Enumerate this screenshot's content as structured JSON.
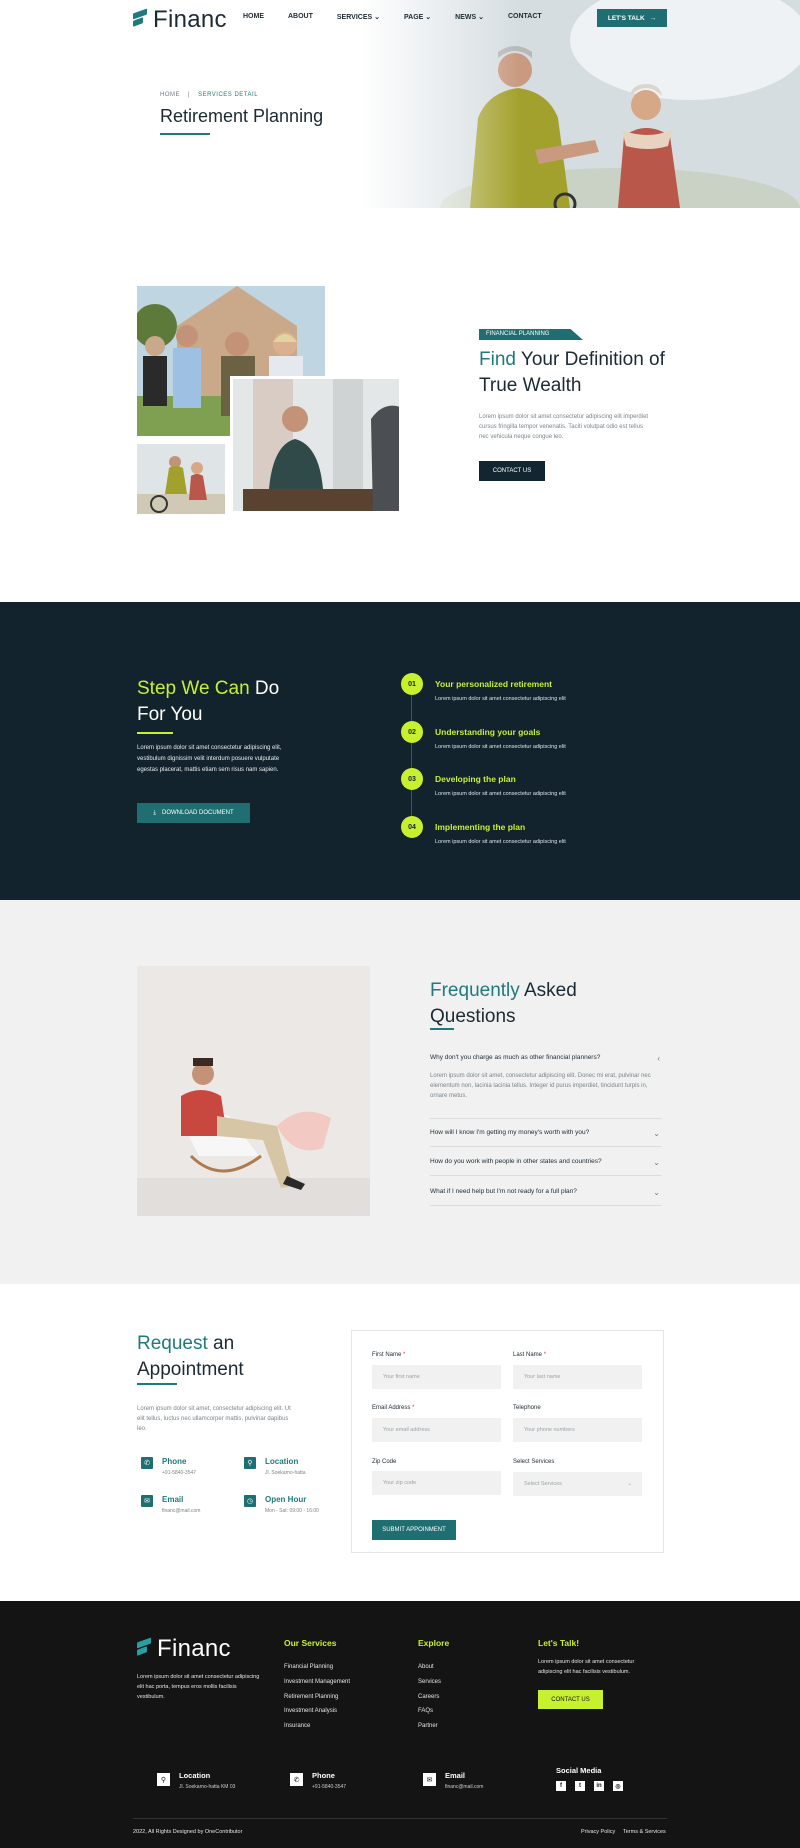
{
  "header": {
    "logo": "Financ",
    "nav": [
      "HOME",
      "ABOUT",
      "SERVICES",
      "PAGE",
      "NEWS",
      "CONTACT"
    ],
    "nav_dropdowns": [
      "SERVICES",
      "PAGE",
      "NEWS"
    ],
    "cta": "LET'S TALK"
  },
  "hero": {
    "breadcrumb_home": "HOME",
    "breadcrumb_current": "SERVICES DETAIL",
    "title": "Retirement Planning"
  },
  "wealth": {
    "tag": "FINANCIAL PLANNING",
    "title_highlight": "Find",
    "title_rest": " Your Definition of",
    "title_line2": "True Wealth",
    "body": "Lorem ipsum dolor sit amet consectetur adipiscing elit imperdiet cursus fringilla tempor venenatis. Taciti volutpat odio est tellus nec vehicula neque congue leo.",
    "button": "CONTACT US"
  },
  "steps": {
    "title_highlight": "Step We Can",
    "title_rest": " Do",
    "title_line2": "For You",
    "body": "Lorem ipsum dolor sit amet consectetur adipiscing elit, vestibulum dignissim velit interdum posuere vulputate egestas placerat, mattis etiam sem risus nam sapien.",
    "button": "DOWNLOAD DOCUMENT",
    "items": [
      {
        "num": "01",
        "title": "Your personalized retirement",
        "desc": "Lorem ipsum dolor sit amet consectetur adipiscing elit"
      },
      {
        "num": "02",
        "title": "Understanding your goals",
        "desc": "Lorem ipsum dolor sit amet consectetur adipiscing elit"
      },
      {
        "num": "03",
        "title": "Developing the plan",
        "desc": "Lorem ipsum dolor sit amet consectetur adipiscing elit"
      },
      {
        "num": "04",
        "title": "Implementing the plan",
        "desc": "Lorem ipsum dolor sit amet consectetur adipiscing elit"
      }
    ]
  },
  "faq": {
    "title_highlight": "Frequently",
    "title_rest": " Asked",
    "title_line2": "Questions",
    "items": [
      {
        "q": "Why don't you charge as much as other financial planners?",
        "a": "Lorem ipsum dolor sit amet, consectetur adipiscing elit. Donec mi erat, pulvinar nec elementum non, lacinia lacinia tellus. Integer id purus imperdiet, tincidunt turpis in, ornare metus.",
        "open": true
      },
      {
        "q": "How will I know I'm getting my money's worth with you?",
        "open": false
      },
      {
        "q": "How do you work with people in other states and countries?",
        "open": false
      },
      {
        "q": "What if I need help but I'm not ready for a full plan?",
        "open": false
      }
    ]
  },
  "appointment": {
    "title_highlight": "Request",
    "title_rest": " an",
    "title_line2": "Appointment",
    "body": "Lorem ipsum dolor sit amet, consectetur adipiscing elit. Ut elit tellus, luctus nec ullamcorper mattis, pulvinar dapibus leo.",
    "info": [
      {
        "icon": "phone-icon",
        "title": "Phone",
        "value": "+91-5840-3547"
      },
      {
        "icon": "location-icon",
        "title": "Location",
        "value": "Jl. Soekarno-hatta"
      },
      {
        "icon": "email-icon",
        "title": "Email",
        "value": "financ@mail.com"
      },
      {
        "icon": "clock-icon",
        "title": "Open Hour",
        "value": "Mon - Sat: 09:00 - 16:00"
      }
    ],
    "form": {
      "first_name_label": "First Name",
      "first_name_placeholder": "Your first name",
      "last_name_label": "Last Name",
      "last_name_placeholder": "Your last name",
      "email_label": "Email Address",
      "email_placeholder": "Your email address",
      "telephone_label": "Telephone",
      "telephone_placeholder": "Your phone numbers",
      "zip_label": "Zip Code",
      "zip_placeholder": "Your zip code",
      "services_label": "Select Services",
      "services_value": "Select Services",
      "submit": "SUBMIT APPOINMENT",
      "required_mark": "*"
    }
  },
  "footer": {
    "logo": "Financ",
    "about": "Lorem ipsum dolor sit amet consectetur adipiscing elit hac porta, tempus eros mollis facilisis vestibulum.",
    "services_title": "Our Services",
    "services": [
      "Financial Planning",
      "Investment Management",
      "Retirement Planning",
      "Investment Analysis",
      "Insurance"
    ],
    "explore_title": "Explore",
    "explore": [
      "About",
      "Services",
      "Careers",
      "FAQs",
      "Partner"
    ],
    "talk_title": "Let's Talk!",
    "talk_text": "Lorem ipsum dolor sit amet consectetur adipiscing elit hac facilisis vestibulum.",
    "talk_button": "CONTACT US",
    "contact": [
      {
        "icon": "location-icon",
        "title": "Location",
        "value": "Jl. Soekarno-hatta KM 03"
      },
      {
        "icon": "phone-icon",
        "title": "Phone",
        "value": "+91-5840-3547"
      },
      {
        "icon": "email-icon",
        "title": "Email",
        "value": "financ@mail.com"
      }
    ],
    "social_title": "Social Media",
    "social": [
      "facebook-icon",
      "twitter-icon",
      "linkedin-icon",
      "instagram-icon"
    ],
    "copyright": "2022, All Rights Designed by OneContributor",
    "privacy": "Privacy Policy",
    "terms": "Terms & Services"
  },
  "colors": {
    "teal": "#1f6e72",
    "dark": "#13232d",
    "lime": "#c7f02f",
    "footer": "#141414"
  }
}
